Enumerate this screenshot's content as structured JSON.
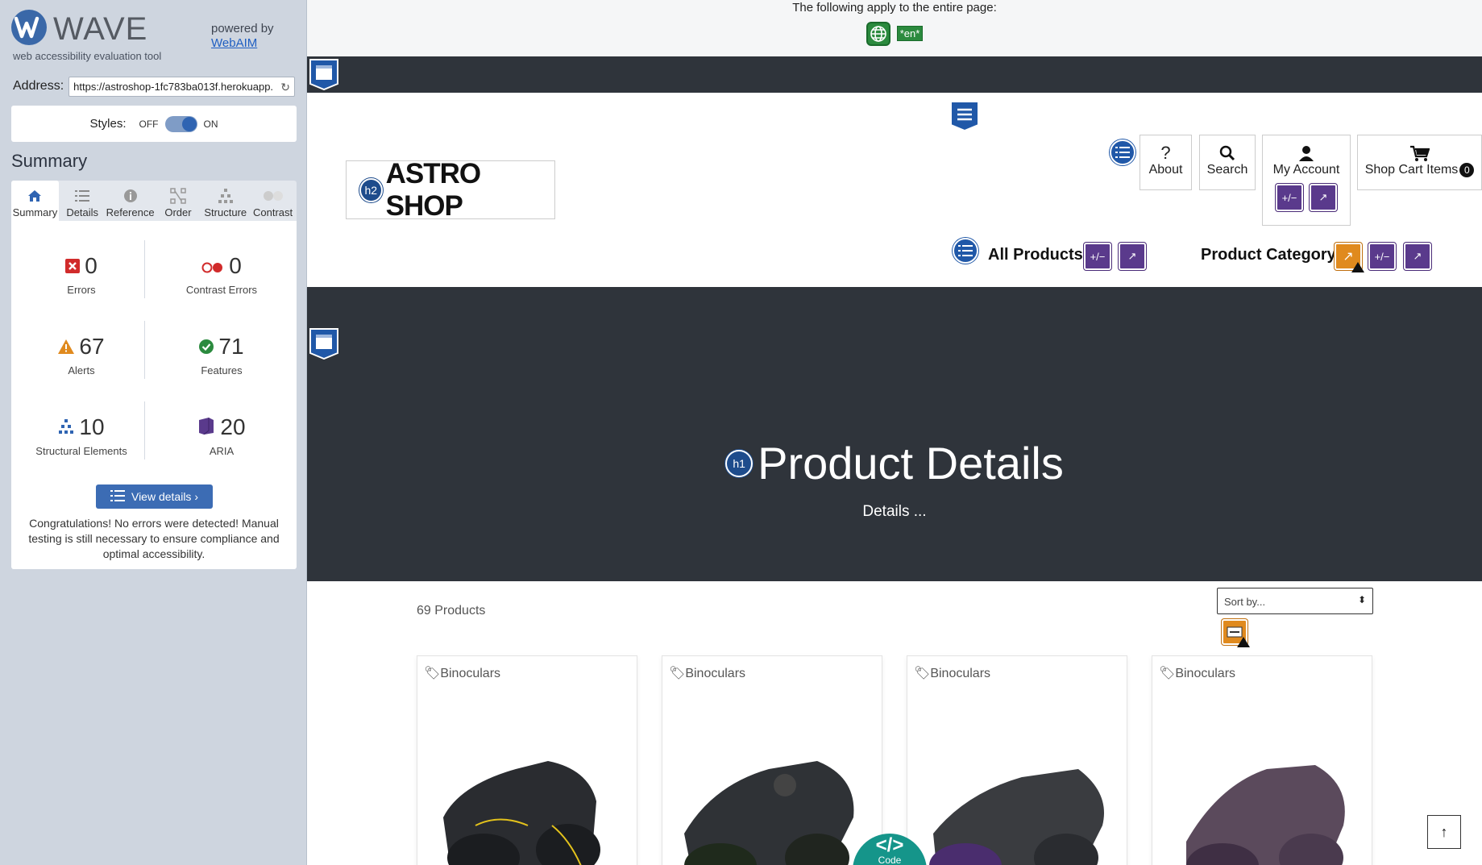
{
  "wave": {
    "brand": "WAVE",
    "tagline": "web accessibility evaluation tool",
    "powered_by": "powered by",
    "webaim_link": "WebAIM",
    "address_label": "Address:",
    "address_value": "https://astroshop-1fc783ba013f.herokuapp.",
    "styles_label": "Styles:",
    "styles_off": "OFF",
    "styles_on": "ON",
    "summary_title": "Summary",
    "tabs": [
      {
        "label": "Summary",
        "icon": "home-icon"
      },
      {
        "label": "Details",
        "icon": "list-icon"
      },
      {
        "label": "Reference",
        "icon": "info-icon"
      },
      {
        "label": "Order",
        "icon": "order-icon"
      },
      {
        "label": "Structure",
        "icon": "structure-icon"
      },
      {
        "label": "Contrast",
        "icon": "contrast-icon"
      }
    ],
    "stats": {
      "errors": {
        "value": "0",
        "label": "Errors"
      },
      "contrast": {
        "value": "0",
        "label": "Contrast Errors"
      },
      "alerts": {
        "value": "67",
        "label": "Alerts"
      },
      "features": {
        "value": "71",
        "label": "Features"
      },
      "structural": {
        "value": "10",
        "label": "Structural Elements"
      },
      "aria": {
        "value": "20",
        "label": "ARIA"
      }
    },
    "view_details": "View details ›",
    "congrats": "Congratulations! No errors were detected! Manual testing is still necessary to ensure compliance and optimal accessibility."
  },
  "page": {
    "apply_text": "The following apply to the entire page:",
    "lang_badge": "*en*",
    "logo_heading": "h2",
    "logo_text": "ASTRO SHOP",
    "nav": {
      "about": "About",
      "search": "Search",
      "account": "My Account",
      "cart": "Shop Cart Items",
      "cart_count": "0"
    },
    "menu": {
      "all_products": "All Products",
      "product_category": "Product Category"
    },
    "aria_label": "+/−",
    "hero_heading": "h1",
    "hero_title": "Product Details",
    "hero_subtitle": "Details ...",
    "product_count": "69 Products",
    "sort_placeholder": "Sort by...",
    "cards": [
      {
        "category": "Binoculars"
      },
      {
        "category": "Binoculars"
      },
      {
        "category": "Binoculars"
      },
      {
        "category": "Binoculars"
      }
    ],
    "code_tab": "Code",
    "code_symbol": "</>"
  },
  "colors": {
    "sidebar_bg": "#ced5df",
    "dark_band": "#2f343b",
    "aria_purple": "#5a3a8c",
    "wave_blue": "#2058a8",
    "code_teal": "#15958a"
  }
}
